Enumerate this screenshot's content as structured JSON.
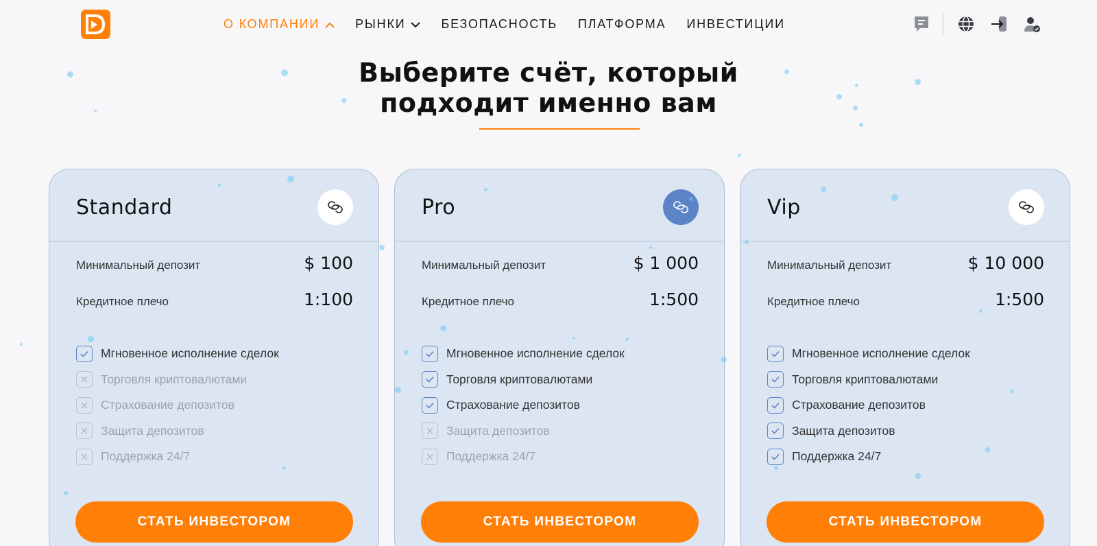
{
  "header": {
    "logo_icon": "logo-icon",
    "nav": [
      {
        "label": "О КОМПАНИИ",
        "active": true,
        "icon": "chevron-up-icon"
      },
      {
        "label": "РЫНКИ",
        "active": false,
        "icon": "chevron-down-icon"
      },
      {
        "label": "БЕЗОПАСНОСТЬ",
        "active": false
      },
      {
        "label": "ПЛАТФОРМА",
        "active": false
      },
      {
        "label": "ИНВЕСТИЦИИ",
        "active": false
      }
    ],
    "icons": [
      "chat-icon",
      "globe-icon",
      "login-icon",
      "user-verified-icon"
    ]
  },
  "heading": {
    "line1": "Выберите счёт, который",
    "line2": "подходит именно вам"
  },
  "colors": {
    "accent": "#ff7f07",
    "card_bg": "#dce6f3",
    "highlight_icon": "#5b84c6"
  },
  "plans": [
    {
      "name": "Standard",
      "icon": "link-icon",
      "deposit_label": "Минимальный депозит",
      "deposit_value": "$ 100",
      "leverage_label": "Кредитное плечо",
      "leverage_value": "1:100",
      "features": [
        {
          "label": "Мгновенное исполнение сделок",
          "included": true
        },
        {
          "label": "Торговля криптовалютами",
          "included": false
        },
        {
          "label": "Страхование депозитов",
          "included": false
        },
        {
          "label": "Защита депозитов",
          "included": false
        },
        {
          "label": "Поддержка 24/7",
          "included": false
        }
      ],
      "cta": "СТАТЬ ИНВЕСТОРОМ"
    },
    {
      "name": "Pro",
      "icon": "link-icon",
      "deposit_label": "Минимальный депозит",
      "deposit_value": "$ 1 000",
      "leverage_label": "Кредитное плечо",
      "leverage_value": "1:500",
      "features": [
        {
          "label": "Мгновенное исполнение сделок",
          "included": true
        },
        {
          "label": "Торговля криптовалютами",
          "included": true
        },
        {
          "label": "Страхование депозитов",
          "included": true
        },
        {
          "label": "Защита депозитов",
          "included": false
        },
        {
          "label": "Поддержка 24/7",
          "included": false
        }
      ],
      "cta": "СТАТЬ ИНВЕСТОРОМ"
    },
    {
      "name": "Vip",
      "icon": "link-icon",
      "deposit_label": "Минимальный депозит",
      "deposit_value": "$ 10 000",
      "leverage_label": "Кредитное плечо",
      "leverage_value": "1:500",
      "features": [
        {
          "label": "Мгновенное исполнение сделок",
          "included": true
        },
        {
          "label": "Торговля криптовалютами",
          "included": true
        },
        {
          "label": "Страхование депозитов",
          "included": true
        },
        {
          "label": "Защита депозитов",
          "included": true
        },
        {
          "label": "Поддержка 24/7",
          "included": true
        }
      ],
      "cta": "СТАТЬ ИНВЕСТОРОМ"
    }
  ]
}
